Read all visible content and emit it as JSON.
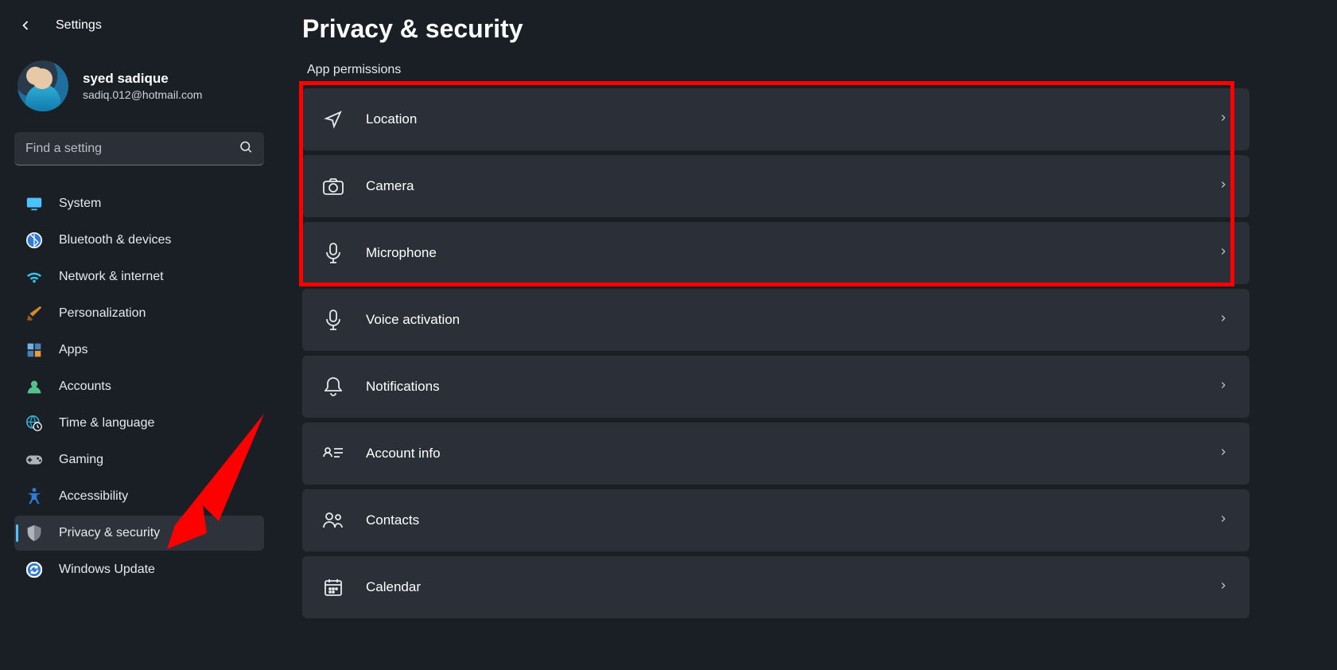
{
  "header": {
    "back_aria": "Back",
    "title": "Settings"
  },
  "profile": {
    "name": "syed sadique",
    "email": "sadiq.012@hotmail.com"
  },
  "search": {
    "placeholder": "Find a setting"
  },
  "sidebar": {
    "items": [
      {
        "icon": "monitor-icon",
        "label": "System",
        "color": "#4cc2ff"
      },
      {
        "icon": "bluetooth-icon",
        "label": "Bluetooth & devices",
        "color": "#2f7bd6"
      },
      {
        "icon": "wifi-icon",
        "label": "Network & internet",
        "color": "#35c0e6"
      },
      {
        "icon": "brush-icon",
        "label": "Personalization",
        "color": "#d38b2b"
      },
      {
        "icon": "apps-icon",
        "label": "Apps",
        "color": "#9aa0a8"
      },
      {
        "icon": "person-icon",
        "label": "Accounts",
        "color": "#55c08b"
      },
      {
        "icon": "globe-clock-icon",
        "label": "Time & language",
        "color": "#2fb0d6"
      },
      {
        "icon": "gamepad-icon",
        "label": "Gaming",
        "color": "#9aa0a8"
      },
      {
        "icon": "accessibility-icon",
        "label": "Accessibility",
        "color": "#2f7bd6"
      },
      {
        "icon": "shield-icon",
        "label": "Privacy & security",
        "color": "#aeb4bb"
      },
      {
        "icon": "update-icon",
        "label": "Windows Update",
        "color": "#2f7bd6"
      }
    ],
    "active_index": 9
  },
  "main": {
    "title": "Privacy & security",
    "section_label": "App permissions",
    "permissions": [
      {
        "icon": "location-arrow-icon",
        "label": "Location"
      },
      {
        "icon": "camera-icon",
        "label": "Camera"
      },
      {
        "icon": "microphone-icon",
        "label": "Microphone"
      },
      {
        "icon": "microphone-icon",
        "label": "Voice activation"
      },
      {
        "icon": "bell-icon",
        "label": "Notifications"
      },
      {
        "icon": "account-card-icon",
        "label": "Account info"
      },
      {
        "icon": "contacts-icon",
        "label": "Contacts"
      },
      {
        "icon": "calendar-icon",
        "label": "Calendar"
      }
    ],
    "highlighted_count": 3
  },
  "annotations": {
    "highlight_box": true,
    "red_arrow_target": "Privacy & security"
  }
}
